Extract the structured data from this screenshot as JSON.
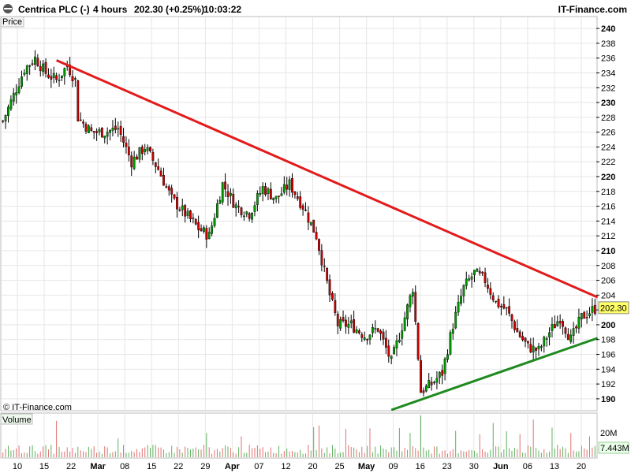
{
  "header": {
    "instrument": "Centrica PLC (-)",
    "timeframe": "4 hours",
    "price_change": "202.30 (+0.25%)",
    "time": "10:03:22",
    "brand": "IT-Finance.com"
  },
  "panels": {
    "price_label": "Price",
    "volume_label": "Volume",
    "watermark": "© IT-Finance.com"
  },
  "colors": {
    "up": "#009a00",
    "down": "#cc0000",
    "resistance": "#e31b1b",
    "support": "#1f8a1f",
    "grid": "#e6e6e6",
    "last_price_bg": "#ffff66",
    "volume_tag_bg": "#e9ffe9"
  },
  "chart_data": {
    "type": "candlestick",
    "y_axis": {
      "ticks": [
        "190",
        "192",
        "194",
        "196",
        "198",
        "200",
        "202",
        "204",
        "206",
        "208",
        "210",
        "212",
        "214",
        "216",
        "218",
        "220",
        "222",
        "224",
        "226",
        "228",
        "230",
        "232",
        "234",
        "236",
        "238",
        "240"
      ],
      "major_ticks": [
        "190",
        "200",
        "210",
        "220",
        "230",
        "240"
      ],
      "range": [
        188.5,
        241.5
      ]
    },
    "x_axis": {
      "labels": [
        "10",
        "15",
        "22",
        "Mar",
        "08",
        "15",
        "22",
        "29",
        "Apr",
        "07",
        "12",
        "20",
        "25",
        "May",
        "09",
        "16",
        "23",
        "30",
        "Jun",
        "06",
        "13",
        "20"
      ],
      "major_labels": [
        "Mar",
        "Apr",
        "May",
        "Jun"
      ]
    },
    "last_price": "202.30",
    "path_anchors": [
      [
        0,
        227.5
      ],
      [
        4,
        231
      ],
      [
        8,
        234.5
      ],
      [
        12,
        236
      ],
      [
        16,
        234
      ],
      [
        20,
        233
      ],
      [
        24,
        235
      ],
      [
        27,
        233
      ],
      [
        28,
        228
      ],
      [
        33,
        226
      ],
      [
        38,
        226
      ],
      [
        43,
        226.5
      ],
      [
        48,
        222
      ],
      [
        53,
        224
      ],
      [
        58,
        221
      ],
      [
        63,
        217
      ],
      [
        68,
        215
      ],
      [
        73,
        213
      ],
      [
        77,
        212
      ],
      [
        82,
        219
      ],
      [
        87,
        216
      ],
      [
        92,
        215
      ],
      [
        97,
        218.5
      ],
      [
        102,
        217
      ],
      [
        107,
        219
      ],
      [
        112,
        216
      ],
      [
        117,
        212
      ],
      [
        122,
        204
      ],
      [
        125,
        200
      ],
      [
        130,
        200
      ],
      [
        135,
        198.5
      ],
      [
        140,
        199.5
      ],
      [
        145,
        195
      ],
      [
        150,
        201
      ],
      [
        153,
        205
      ],
      [
        156,
        191
      ],
      [
        160,
        192
      ],
      [
        164,
        193.5
      ],
      [
        168,
        200
      ],
      [
        172,
        205
      ],
      [
        176,
        207
      ],
      [
        180,
        206
      ],
      [
        184,
        203
      ],
      [
        188,
        202
      ],
      [
        192,
        199
      ],
      [
        196,
        197
      ],
      [
        200,
        196.5
      ],
      [
        204,
        199
      ],
      [
        208,
        201
      ],
      [
        212,
        198
      ],
      [
        216,
        201
      ],
      [
        220,
        202
      ],
      [
        222,
        202.3
      ]
    ],
    "candle_count": 222,
    "resistance_line": {
      "from": [
        20,
        235.7
      ],
      "to": [
        222,
        203.7
      ]
    },
    "support_line": {
      "from": [
        145,
        188.5
      ],
      "to": [
        222,
        198.2
      ]
    },
    "volume": {
      "scale_label": "20M",
      "last_value": "7.443M",
      "spikes": [
        [
          20,
          0.87
        ],
        [
          43,
          0.45
        ],
        [
          76,
          0.58
        ],
        [
          89,
          0.5
        ],
        [
          116,
          0.72
        ],
        [
          118,
          0.76
        ],
        [
          128,
          0.68
        ],
        [
          137,
          0.69
        ],
        [
          148,
          0.7
        ],
        [
          152,
          0.58
        ],
        [
          156,
          1.0
        ],
        [
          169,
          0.63
        ],
        [
          178,
          0.55
        ],
        [
          183,
          0.82
        ],
        [
          188,
          0.62
        ],
        [
          193,
          0.55
        ],
        [
          198,
          0.9
        ],
        [
          205,
          0.71
        ],
        [
          212,
          0.58
        ],
        [
          219,
          0.5
        ]
      ]
    }
  }
}
